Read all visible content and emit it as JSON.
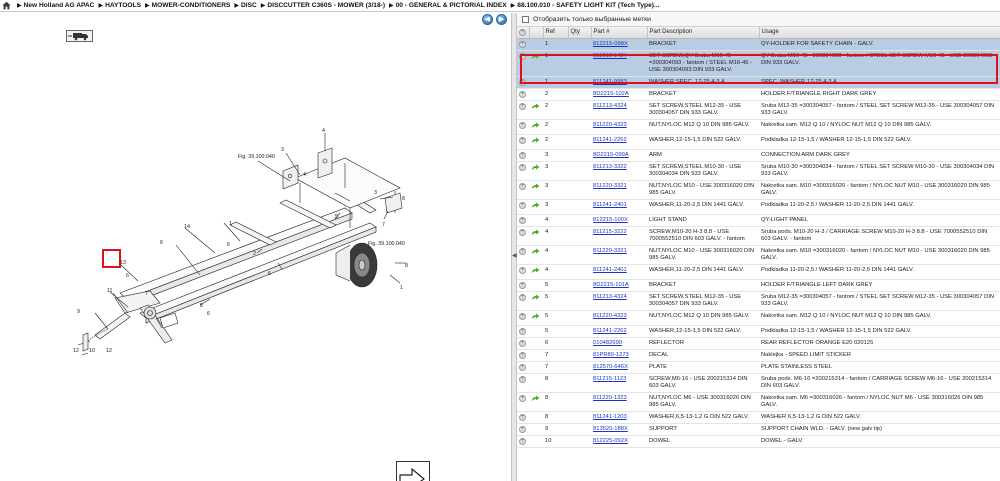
{
  "breadcrumb": [
    "New Holland AG APAC",
    "HAYTOOLS",
    "MOWER-CONDITIONERS",
    "DISC",
    "DISCCUTTER C360S - MOWER (3/18-)",
    "00 - GENERAL & PICTORIAL INDEX",
    "88.100.010 - SAFETY LIGHT KIT (Tech Type)..."
  ],
  "nav": {
    "prev_label": "◀",
    "next_label": "▶"
  },
  "filter": {
    "label": "Отобразить только выбранные метки"
  },
  "columns": [
    "Ref",
    "Qty",
    "Part #",
    "Part Description",
    "Usage"
  ],
  "diagram": {
    "fig_label_1": "Fig. 39.100.040",
    "fig_label_2": "Fig. 39.100.040",
    "callouts": [
      "4",
      "3",
      "4",
      "6",
      "1",
      "5",
      "14",
      "6",
      "13",
      "8",
      "11",
      "9",
      "12",
      "10",
      "12",
      "7",
      "2",
      "6",
      "6",
      "7",
      "8",
      "8",
      "1",
      "3",
      "6"
    ]
  },
  "rows": [
    {
      "type": "add",
      "ref": "1",
      "qty": "",
      "part": "812215-098X",
      "desc": "BRACKET",
      "usage": "QY-HOLDER FOR SAFETY CHAIN - GALV.",
      "sel": true
    },
    {
      "type": "go",
      "ref": "1",
      "qty": "",
      "part": "811213-5424",
      "desc": "SET SCREW,QY-Sruba M16-45 =300304093 - fantom / STEEL M16-45 - USE 300304093 DIN 933 GALV.",
      "usage": "QY-Sruba M16-45 =300304093 - fantom / STEEL SET SCREW M16-45 - USE 300304093 DIN 933 GALV.",
      "sel": true
    },
    {
      "type": "add",
      "ref": "1",
      "qty": "",
      "part": "811241-9983",
      "desc": "WASHER,SPEC. 17-25,4-3,4",
      "usage": "SPEC. WASHER 17-25,4-3,4",
      "sel": true
    },
    {
      "type": "add",
      "ref": "2",
      "qty": "",
      "part": "8D2215-102A",
      "desc": "BRACKET",
      "usage": "HOLDER F/TRIANGLE RIGHT DARK GREY"
    },
    {
      "type": "go",
      "ref": "2",
      "qty": "",
      "part": "811213-4324",
      "desc": "SET SCREW,STEEL M12-35 - USE 300304057 DIN 933 GALV.",
      "usage": "Sruba M12-35 =300304057 - fantom / STEEL SET SCREW M12-35 - USE 300304057 DIN 933 GALV."
    },
    {
      "type": "go",
      "ref": "2",
      "qty": "",
      "part": "811220-4323",
      "desc": "NUT,NYLOC M12 Q 10 DIN 985 GALV.",
      "usage": "Nakretka sam. M12 Q 10 / NYLOC NUT M12 Q 10 DIN 985 GALV."
    },
    {
      "type": "go",
      "ref": "2",
      "qty": "",
      "part": "811241-2262",
      "desc": "WASHER,12-15-1,5 DIN 522 GALV.",
      "usage": "Podkladka 12-15-1,5 / WASHER 12-15-1,5 DIN 522 GALV."
    },
    {
      "type": "add",
      "ref": "3",
      "qty": "",
      "part": "8D2215-099A",
      "desc": "ARM",
      "usage": "CONNECTION ARM DARK GREY"
    },
    {
      "type": "go",
      "ref": "3",
      "qty": "",
      "part": "811213-3322",
      "desc": "SET SCREW,STEEL M10-30 - USE 300304034 DIN 933 GALV.",
      "usage": "Sruba M10-30 =300304034 - fantom / STEEL SET SCREW M10-30 - USE 300304034 DIN 933 GALV."
    },
    {
      "type": "go",
      "ref": "3",
      "qty": "",
      "part": "811220-3321",
      "desc": "NUT,NYLOC M10 - USE 300316020 DIN 985 GALV.",
      "usage": "Nakretka sam. M10 =300316020 - fantom / NYLOC NUT M10 - USE 300316020 DIN 985 GALV."
    },
    {
      "type": "go",
      "ref": "3",
      "qty": "",
      "part": "811241-2401",
      "desc": "WASHER,11-20-2,5 DIN 1441 GALV.",
      "usage": "Podkladka 11-20-2,5 / WASHER 11-20-2,5 DIN 1441 GALV."
    },
    {
      "type": "add",
      "ref": "4",
      "qty": "",
      "part": "812215-100X",
      "desc": "LIGHT STAND",
      "usage": "QY-LIGHT PANEL"
    },
    {
      "type": "go",
      "ref": "4",
      "qty": "",
      "part": "811215-3222",
      "desc": "SCREW,M10-20 H-3 8.8 - USE 7000552510 DIN 603 GALV. - fantom",
      "usage": "Sruba pods. M10-20 H-3 / CARRIAGE SCREW M10-20 H-3 8.8 - USE 7000552510 DIN 603 GALV. - fantom"
    },
    {
      "type": "go",
      "ref": "4",
      "qty": "",
      "part": "811220-3321",
      "desc": "NUT,NYLOC M10 - USE 300316020 DIN 985 GALV.",
      "usage": "Nakretka sam. M10 =300316020 - fantom / NYLOC NUT M10 - USE 300316020 DIN 985 GALV."
    },
    {
      "type": "go",
      "ref": "4",
      "qty": "",
      "part": "811241-2401",
      "desc": "WASHER,11-20-2,5 DIN 1441 GALV.",
      "usage": "Podkladka 11-20-2,5 / WASHER 11-20-2,5 DIN 1441 GALV."
    },
    {
      "type": "add",
      "ref": "5",
      "qty": "",
      "part": "8D2215-101A",
      "desc": "BRACKET",
      "usage": "HOLDER F/TRIANGLE LEFT DARK GREY"
    },
    {
      "type": "go",
      "ref": "5",
      "qty": "",
      "part": "811213-4324",
      "desc": "SET SCREW,STEEL M12-35 - USE 300304057 DIN 933 GALV.",
      "usage": "Sruba M12-35 =300304057 - fantom / STEEL SET SCREW M12-35 - USE 300304057 DIN 933 GALV."
    },
    {
      "type": "go",
      "ref": "5",
      "qty": "",
      "part": "811220-4323",
      "desc": "NUT,NYLOC M12 Q 10 DIN 985 GALV.",
      "usage": "Nakretka sam. M12 Q 10 / NYLOC NUT M12 Q 10 DIN 985 GALV."
    },
    {
      "type": "add",
      "ref": "5",
      "qty": "",
      "part": "811241-2262",
      "desc": "WASHER,12-15-1,5 DIN 522 GALV.",
      "usage": "Podkladka 12-15-1,5 / WASHER 12-15-1,5 DIN 522 GALV."
    },
    {
      "type": "add",
      "ref": "6",
      "qty": "",
      "part": "010482690",
      "desc": "REFLECTOR",
      "usage": "REAR REFLECTOR ORANGE E20 020125"
    },
    {
      "type": "add",
      "ref": "7",
      "qty": "",
      "part": "81PR80-1273",
      "desc": "DECAL",
      "usage": "Naklejka - SPEED LIMIT STICKER"
    },
    {
      "type": "add",
      "ref": "7",
      "qty": "",
      "part": "812570-646X",
      "desc": "PLATE",
      "usage": "PLATE STAINLESS STEEL"
    },
    {
      "type": "add",
      "ref": "8",
      "qty": "",
      "part": "811215-1123",
      "desc": "SCREW,M6-16 - USE 200215314 DIN 603 GALV.",
      "usage": "Sruba pods. M6-16 =200215314 - fantom / CARRIAGE SCREW M6-16 - USE 200215314 DIN 603 GALV."
    },
    {
      "type": "go",
      "ref": "8",
      "qty": "",
      "part": "811220-1323",
      "desc": "NUT,NYLOC M6 - USE 300316026 DIN 985 GALV.",
      "usage": "Nakretka sam. M6 =300316026 - fantom / NYLOC NUT M6 - USE 300316026 DIN 985 GALV."
    },
    {
      "type": "add",
      "ref": "8",
      "qty": "",
      "part": "811241-1203",
      "desc": "WASHER,6,5-13-1,2 G DIN 522 GALV.",
      "usage": "WASHER 6,5-13-1,2 G DIN 522 GALV."
    },
    {
      "type": "add",
      "ref": "9",
      "qty": "",
      "part": "813520-188X",
      "desc": "SUPPORT",
      "usage": "SUPPORT CHAIN WLD. - GALV. (new galv tip)"
    },
    {
      "type": "add",
      "ref": "10",
      "qty": "",
      "part": "812225-092X",
      "desc": "DOWEL",
      "usage": "DOWEL - GALV."
    }
  ]
}
